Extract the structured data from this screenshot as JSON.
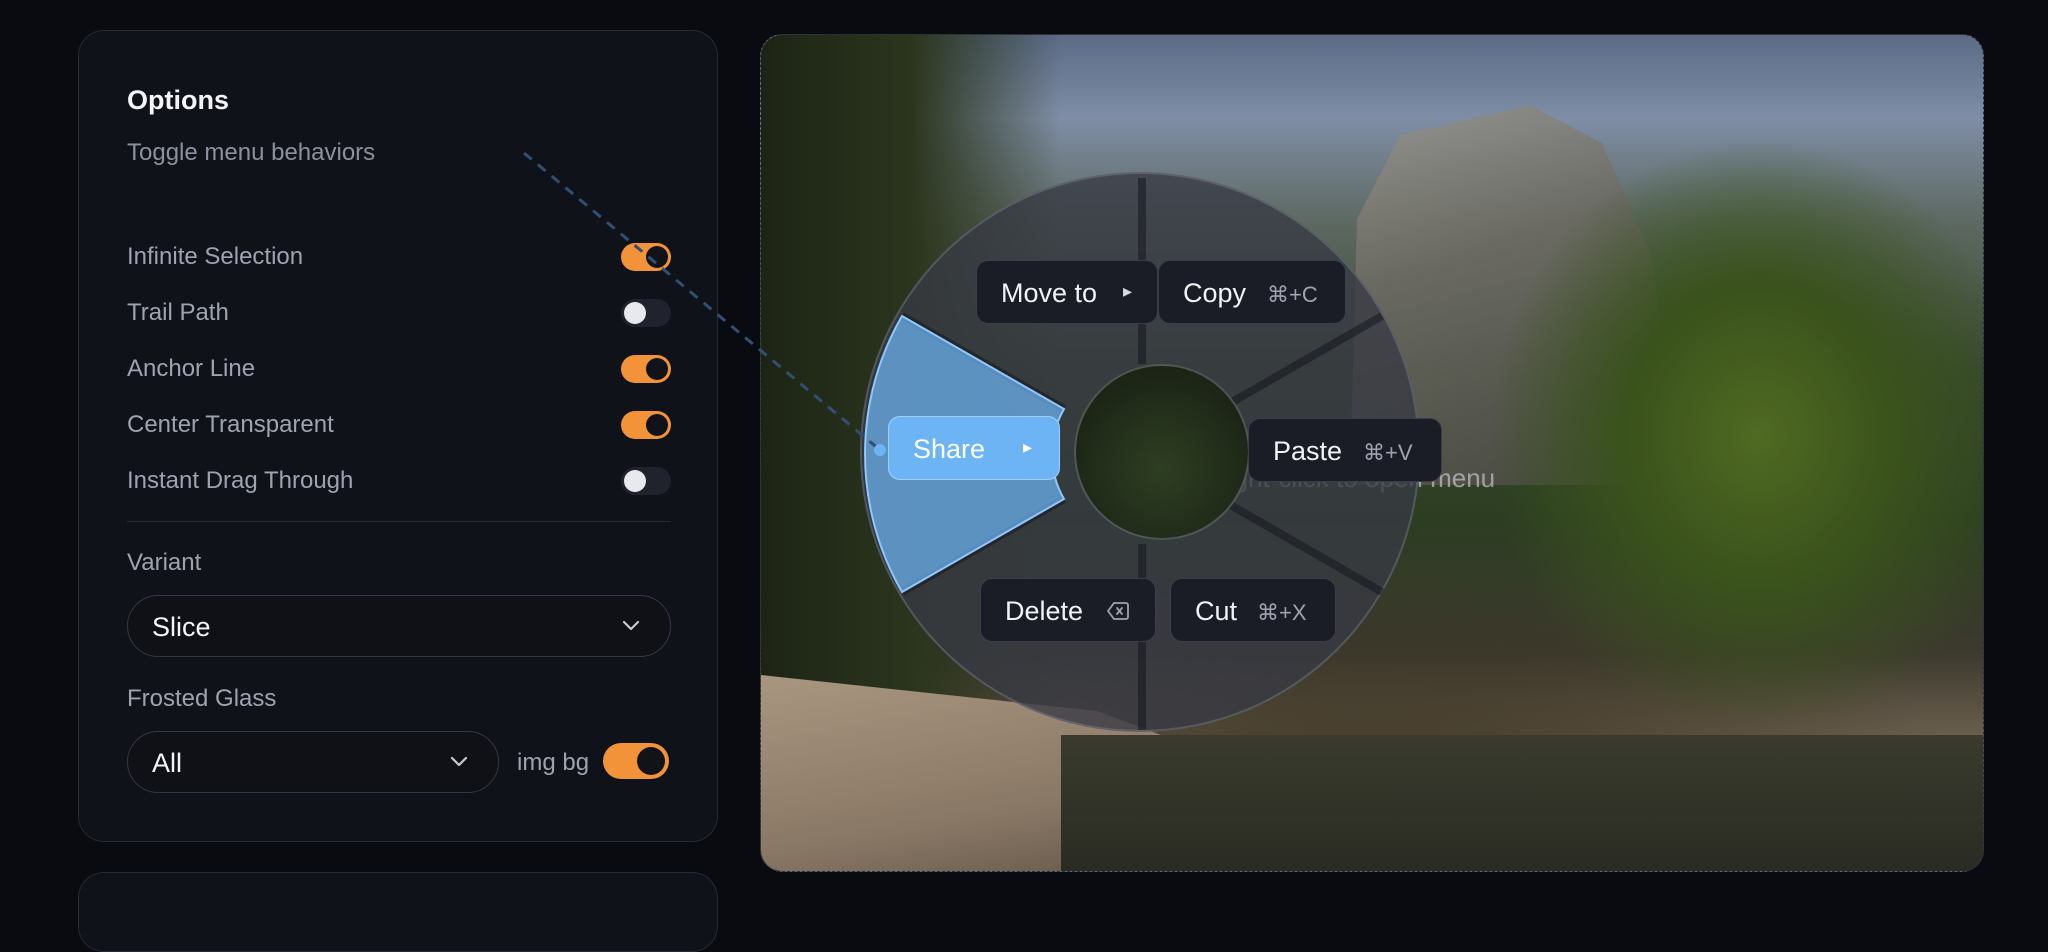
{
  "options": {
    "title": "Options",
    "subtitle": "Toggle menu behaviors",
    "toggles": [
      {
        "label": "Infinite Selection",
        "on": true
      },
      {
        "label": "Trail Path",
        "on": false
      },
      {
        "label": "Anchor Line",
        "on": true
      },
      {
        "label": "Center Transparent",
        "on": true
      },
      {
        "label": "Instant Drag Through",
        "on": false
      }
    ],
    "variant_label": "Variant",
    "variant_value": "Slice",
    "frosted_label": "Frosted Glass",
    "frosted_value": "All",
    "img_bg_label": "img bg",
    "img_bg_on": true
  },
  "scene": {
    "hint": "Right-click to open menu"
  },
  "menu": {
    "items": [
      {
        "label": "Move to",
        "submenu": true,
        "shortcut": ""
      },
      {
        "label": "Copy",
        "submenu": false,
        "shortcut": "⌘+C"
      },
      {
        "label": "Share",
        "submenu": true,
        "shortcut": "",
        "active": true
      },
      {
        "label": "Paste",
        "submenu": false,
        "shortcut": "⌘+V"
      },
      {
        "label": "Delete",
        "submenu": false,
        "shortcut": ""
      },
      {
        "label": "Cut",
        "submenu": false,
        "shortcut": "⌘+X"
      }
    ],
    "submenu_arrow": "▸"
  },
  "colors": {
    "accent": "#f2933a",
    "active_slice": "#6cb4f4",
    "background": "#0a0b10"
  }
}
